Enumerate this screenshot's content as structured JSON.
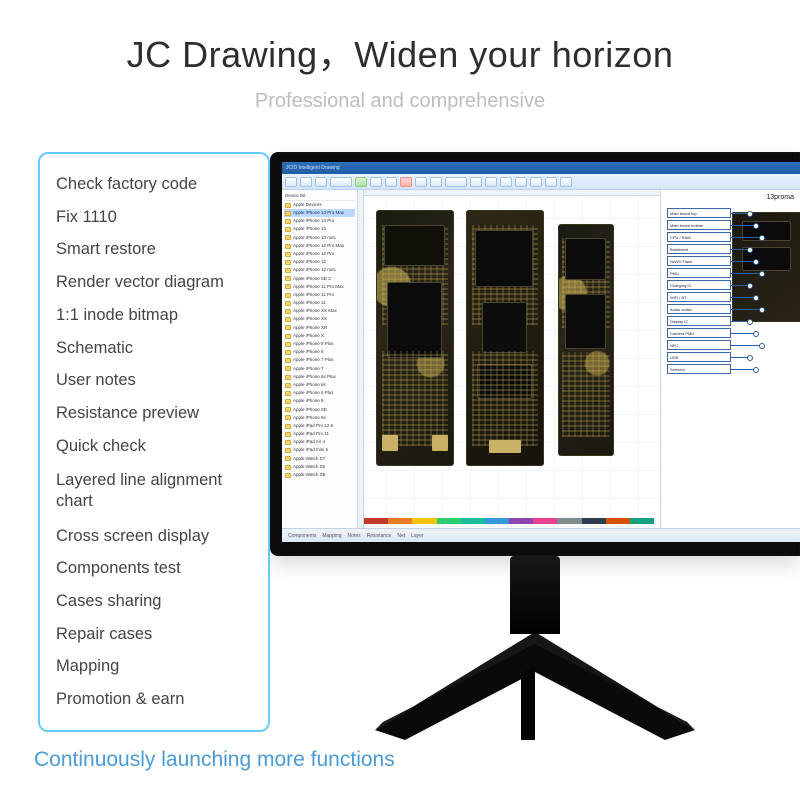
{
  "headline": {
    "title": "JC Drawing，Widen your horizon",
    "subtitle": "Professional and comprehensive"
  },
  "features": [
    "Check factory code",
    "Fix 1110",
    "Smart restore",
    "Render vector diagram",
    "1:1 inode bitmap",
    "Schematic",
    "User notes",
    "Resistance preview",
    "Quick check",
    "Layered line alignment chart",
    "Cross screen display",
    "Components test",
    "Cases sharing",
    "Repair cases",
    "Mapping",
    "Promotion & earn"
  ],
  "footer": "Continuously launching more functions",
  "app": {
    "title": "JCID Intelligent Drawing",
    "tree_header": "Device list",
    "tree_items": [
      "Apple Devices",
      "Apple iPhone 13 Pro Max",
      "Apple iPhone 13 Pro",
      "Apple iPhone 13",
      "Apple iPhone 13 mini",
      "Apple iPhone 12 Pro Max",
      "Apple iPhone 12 Pro",
      "Apple iPhone 12",
      "Apple iPhone 12 mini",
      "Apple iPhone SE 2",
      "Apple iPhone 11 Pro Max",
      "Apple iPhone 11 Pro",
      "Apple iPhone 11",
      "Apple iPhone XS Max",
      "Apple iPhone XS",
      "Apple iPhone XR",
      "Apple iPhone X",
      "Apple iPhone 8 Plus",
      "Apple iPhone 8",
      "Apple iPhone 7 Plus",
      "Apple iPhone 7",
      "Apple iPhone 6s Plus",
      "Apple iPhone 6s",
      "Apple iPhone 6 Plus",
      "Apple iPhone 6",
      "Apple iPhone SE",
      "Apple iPhone 5s",
      "Apple iPad Pro 12.9",
      "Apple iPad Pro 11",
      "Apple iPad Air 4",
      "Apple iPad mini 6",
      "Apple Watch S7",
      "Apple Watch S6",
      "Apple Watch SE"
    ],
    "tree_selected_index": 1,
    "right_title": "13proma",
    "right_labels": [
      "Main board top",
      "Main board bottom",
      "CPU / RAM",
      "Baseband",
      "NAND Flash",
      "PMU",
      "Charging IC",
      "WiFi / BT",
      "Audio codec",
      "Display IC",
      "Camera PMU",
      "NFC",
      "USB",
      "Sensors"
    ],
    "status_items": [
      "Components",
      "Mapping",
      "Notes",
      "Resistance",
      "Net",
      "Layer"
    ],
    "swatch_colors": [
      "#c0392b",
      "#e67e22",
      "#f1c40f",
      "#2ecc71",
      "#1abc9c",
      "#3498db",
      "#8e44ad",
      "#e84393",
      "#7f8c8d",
      "#2c3e50",
      "#d35400",
      "#16a085"
    ]
  }
}
